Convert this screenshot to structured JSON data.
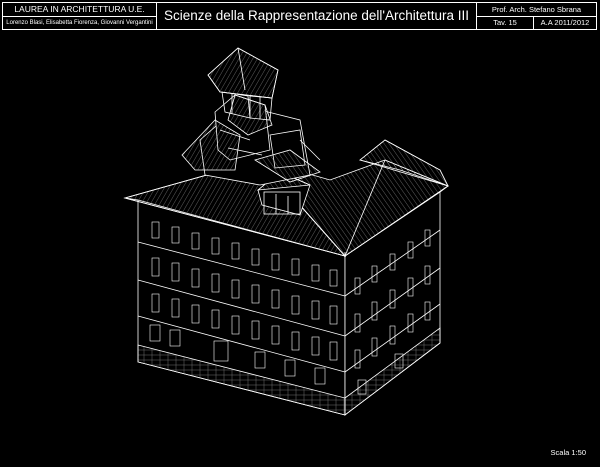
{
  "titleblock": {
    "course": "LAUREA IN ARCHITETTURA U.E.",
    "authors": "Lorenzo Blasi, Elisabetta Fiorenza, Giovanni Vergantini",
    "title": "Scienze della Rappresentazione dell'Architettura III",
    "professor": "Prof. Arch. Stefano Sbrana",
    "sheet": "Tav. 15",
    "academic_year": "A.A 2011/2012"
  },
  "scale_label": "Scala 1:50",
  "colors": {
    "background": "#000000",
    "lines": "#ffffff"
  }
}
